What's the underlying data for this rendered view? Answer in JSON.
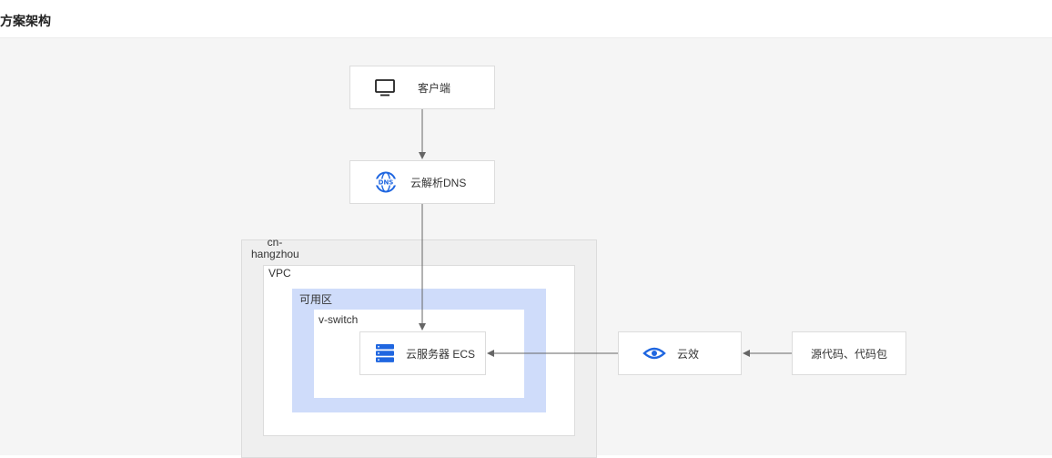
{
  "header": {
    "title": "方案架构"
  },
  "nodes": {
    "client": {
      "label": "客户端",
      "icon": "monitor-icon"
    },
    "dns": {
      "label": "云解析DNS",
      "icon": "dns-icon"
    },
    "ecs": {
      "label": "云服务器 ECS",
      "icon": "server-icon"
    },
    "yunxiao": {
      "label": "云效",
      "icon": "eye-icon"
    },
    "source": {
      "label": "源代码、代码包"
    }
  },
  "containers": {
    "region": {
      "label": "cn-\nhangzhou"
    },
    "vpc": {
      "label": "VPC"
    },
    "zone": {
      "label": "可用区"
    },
    "vswitch": {
      "label": "v-switch"
    }
  },
  "colors": {
    "accent": "#1f66e0",
    "zone_fill": "#cfdcfa",
    "canvas_bg": "#f5f5f5",
    "arrow": "#666666"
  }
}
